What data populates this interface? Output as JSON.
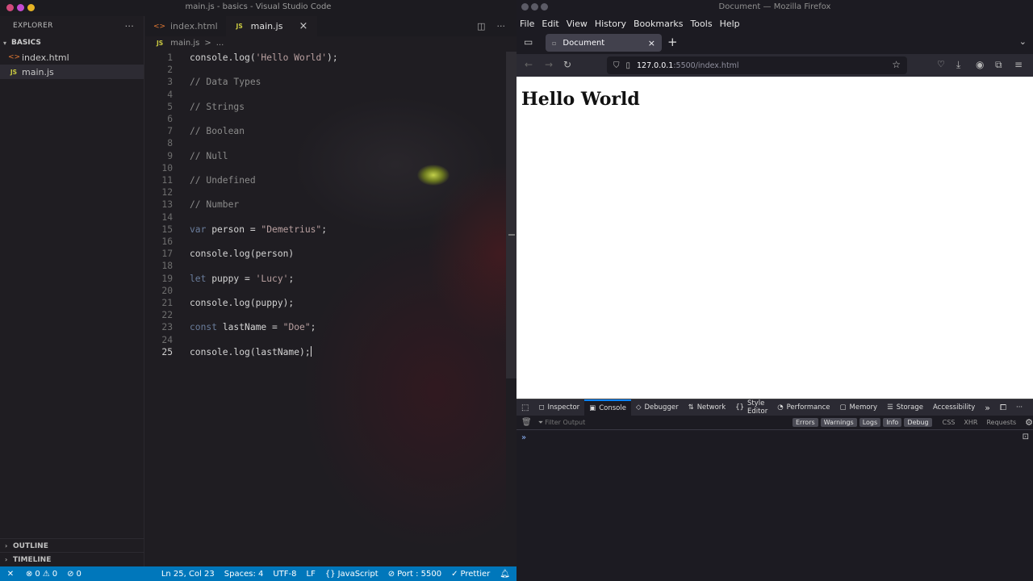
{
  "vscode": {
    "title": "main.js - basics - Visual Studio Code",
    "explorer_label": "EXPLORER",
    "explorer_more": "···",
    "folder": "BASICS",
    "files": [
      {
        "name": "index.html",
        "icon": "<>"
      },
      {
        "name": "main.js",
        "icon": "JS"
      }
    ],
    "outline_label": "OUTLINE",
    "timeline_label": "TIMELINE",
    "tabs": [
      {
        "label": "index.html",
        "icon": "<>"
      },
      {
        "label": "main.js",
        "icon": "JS",
        "close": "×"
      }
    ],
    "breadcrumb": {
      "file": "main.js",
      "sep": ">",
      "rest": "..."
    },
    "code_lines": [
      {
        "n": "1",
        "text": "console.log('Hello World');"
      },
      {
        "n": "2",
        "text": ""
      },
      {
        "n": "3",
        "text": "// Data Types"
      },
      {
        "n": "4",
        "text": ""
      },
      {
        "n": "5",
        "text": "// Strings"
      },
      {
        "n": "6",
        "text": ""
      },
      {
        "n": "7",
        "text": "// Boolean"
      },
      {
        "n": "8",
        "text": ""
      },
      {
        "n": "9",
        "text": "// Null"
      },
      {
        "n": "10",
        "text": ""
      },
      {
        "n": "11",
        "text": "// Undefined"
      },
      {
        "n": "12",
        "text": ""
      },
      {
        "n": "13",
        "text": "// Number"
      },
      {
        "n": "14",
        "text": ""
      },
      {
        "n": "15",
        "text": "var person = \"Demetrius\";"
      },
      {
        "n": "16",
        "text": ""
      },
      {
        "n": "17",
        "text": "console.log(person)"
      },
      {
        "n": "18",
        "text": ""
      },
      {
        "n": "19",
        "text": "let puppy = 'Lucy';"
      },
      {
        "n": "20",
        "text": ""
      },
      {
        "n": "21",
        "text": "console.log(puppy);"
      },
      {
        "n": "22",
        "text": ""
      },
      {
        "n": "23",
        "text": "const lastName = \"Doe\";"
      },
      {
        "n": "24",
        "text": ""
      },
      {
        "n": "25",
        "text": "console.log(lastName);"
      }
    ],
    "code_parts": {
      "l1": [
        "console.log(",
        "'Hello World'",
        ");"
      ],
      "l15": [
        "var",
        " person = ",
        "\"Demetrius\"",
        ";"
      ],
      "l19": [
        "let",
        " puppy = ",
        "'Lucy'",
        ";"
      ],
      "l23": [
        "const",
        " lastName = ",
        "\"Doe\"",
        ";"
      ]
    },
    "status": {
      "errors": "0",
      "warnings": "0",
      "ports": "0",
      "position": "Ln 25, Col 23",
      "spaces": "Spaces: 4",
      "encoding": "UTF-8",
      "eol": "LF",
      "language": "JavaScript",
      "port": "Port : 5500",
      "prettier": "Prettier"
    }
  },
  "firefox": {
    "title": "Document — Mozilla Firefox",
    "menu": [
      "File",
      "Edit",
      "View",
      "History",
      "Bookmarks",
      "Tools",
      "Help"
    ],
    "tab_title": "Document",
    "tab_close": "×",
    "new_tab": "+",
    "url_host": "127.0.0.1",
    "url_rest": ":5500/index.html",
    "page_heading": "Hello World",
    "devtools": {
      "tabs": [
        "Inspector",
        "Console",
        "Debugger",
        "Network",
        "Style Editor",
        "Performance",
        "Memory",
        "Storage",
        "Accessibility"
      ],
      "active_tab": "Console",
      "filter_placeholder": "Filter Output",
      "filters": [
        "Errors",
        "Warnings",
        "Logs",
        "Info",
        "Debug"
      ],
      "extra_filters": [
        "CSS",
        "XHR",
        "Requests"
      ],
      "prompt": "»"
    }
  },
  "colors": {
    "vscode_status": "#0077bb",
    "devtools_accent": "#0a84ff"
  }
}
